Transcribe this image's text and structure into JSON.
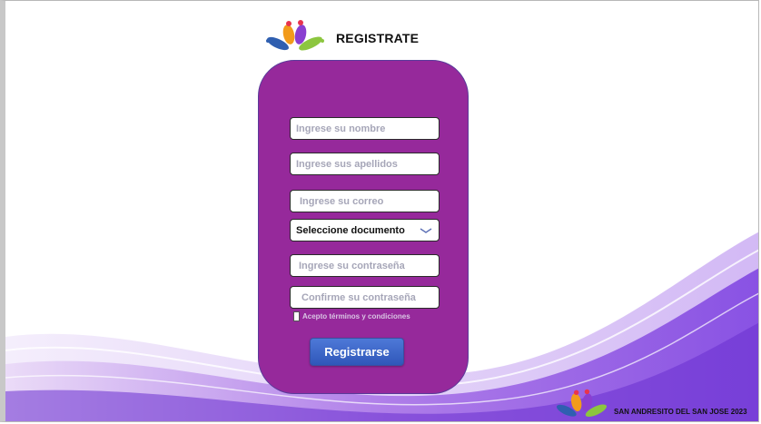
{
  "header": {
    "title": "REGISTRATE"
  },
  "form": {
    "name_placeholder": "Ingrese su nombre",
    "lastname_placeholder": "Ingrese sus apellidos",
    "email_placeholder": "Ingrese su correo",
    "document_select": "Seleccione documento",
    "password_placeholder": "Ingrese su contraseña",
    "confirm_placeholder": "Confirme su contraseña",
    "terms_label": "Acepto términos y condiciones",
    "terms_checked": false,
    "submit_label": "Registrarse"
  },
  "footer": {
    "text": "SAN ANDRESITO DEL SAN JOSE 2023"
  },
  "colors": {
    "card": "#96299b",
    "button": "#3a63c8",
    "accent_purple": "#8a3fd1"
  }
}
